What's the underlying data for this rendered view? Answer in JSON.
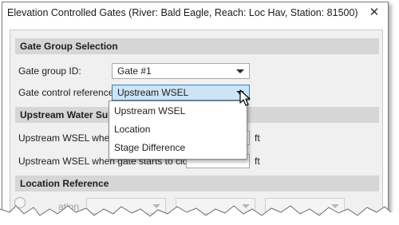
{
  "window": {
    "title": "Elevation Controlled Gates (River: Bald Eagle, Reach: Loc Hav, Station: 81500)",
    "close_glyph": "✕"
  },
  "gate_group": {
    "header": "Gate Group Selection",
    "gate_group_id_label": "Gate group ID:",
    "gate_group_id_value": "Gate #1",
    "control_reference_label": "Gate control reference:",
    "control_reference_value": "Upstream WSEL"
  },
  "dropdown": {
    "options": [
      "Upstream WSEL",
      "Location",
      "Stage Difference"
    ]
  },
  "upstream_section": {
    "header": "Upstream Water Surface",
    "open_label": "Upstream WSEL when ga",
    "open_unit": "ft",
    "close_label": "Upstream WSEL when gate starts to close:",
    "close_unit": "ft"
  },
  "location_section": {
    "header": "Location Reference",
    "partial_label": "ation"
  },
  "colors": {
    "active_combo_bg": "#cce4f7",
    "active_combo_border": "#3c7fb1",
    "section_header_bg": "#d6d6d6"
  }
}
